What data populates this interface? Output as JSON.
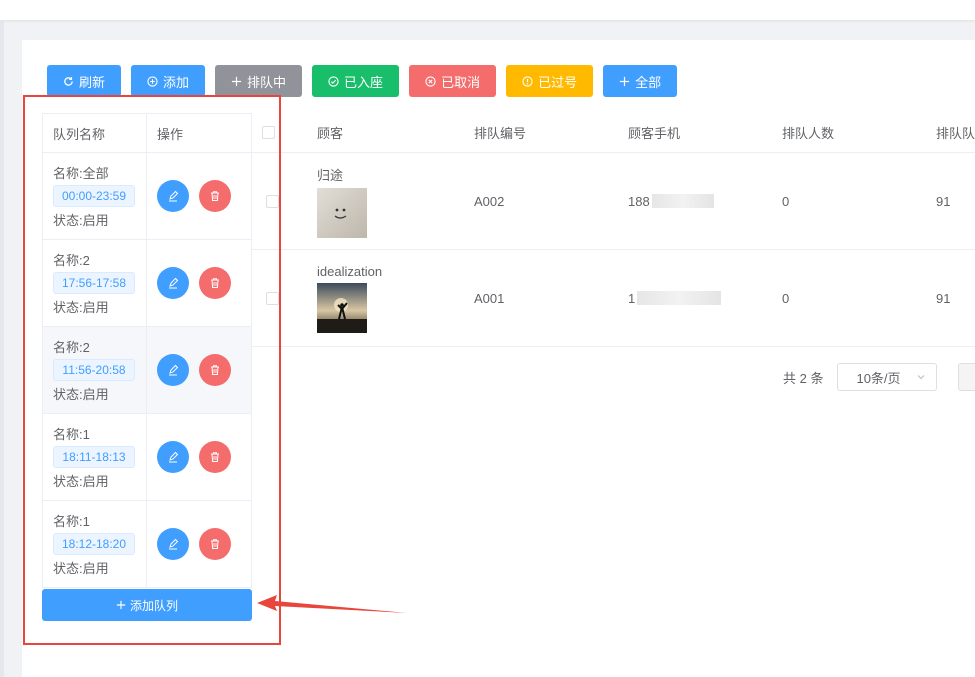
{
  "toolbar": {
    "buttons": [
      {
        "label": "刷新",
        "icon": "refresh-icon",
        "color": "#409eff"
      },
      {
        "label": "添加",
        "icon": "circle-plus-icon",
        "color": "#409eff"
      },
      {
        "label": "排队中",
        "icon": "plus-icon",
        "color": "#909399"
      },
      {
        "label": "已入座",
        "icon": "circle-check-icon",
        "color": "#19be6b"
      },
      {
        "label": "已取消",
        "icon": "circle-close-icon",
        "color": "#f56c6c"
      },
      {
        "label": "已过号",
        "icon": "circle-info-icon",
        "color": "#ffba00"
      },
      {
        "label": "全部",
        "icon": "plus-icon",
        "color": "#409eff"
      }
    ]
  },
  "queue": {
    "headers": {
      "name": "队列名称",
      "ops": "操作"
    },
    "rows": [
      {
        "name": "名称:全部",
        "time": "00:00-23:59",
        "status": "状态:启用"
      },
      {
        "name": "名称:2",
        "time": "17:56-17:58",
        "status": "状态:启用"
      },
      {
        "name": "名称:2",
        "time": "11:56-20:58",
        "status": "状态:启用"
      },
      {
        "name": "名称:1",
        "time": "18:11-18:13",
        "status": "状态:启用"
      },
      {
        "name": "名称:1",
        "time": "18:12-18:20",
        "status": "状态:启用"
      }
    ],
    "add_label": "添加队列"
  },
  "table": {
    "headers": {
      "customer": "顾客",
      "number": "排队编号",
      "phone": "顾客手机",
      "count": "排队人数",
      "time": "排队队"
    },
    "rows": [
      {
        "customer": "归途",
        "number": "A002",
        "phone": "188",
        "count": "0",
        "time": "91"
      },
      {
        "customer": "idealization",
        "number": "A001",
        "phone": "1",
        "count": "0",
        "time": "91"
      }
    ]
  },
  "pagination": {
    "total": "共 2 条",
    "page_size": "10条/页"
  },
  "colors": {
    "primary": "#409eff",
    "danger": "#f56c6c",
    "success": "#19be6b",
    "warning": "#ffba00",
    "info": "#909399",
    "annotation": "#e8453c"
  }
}
